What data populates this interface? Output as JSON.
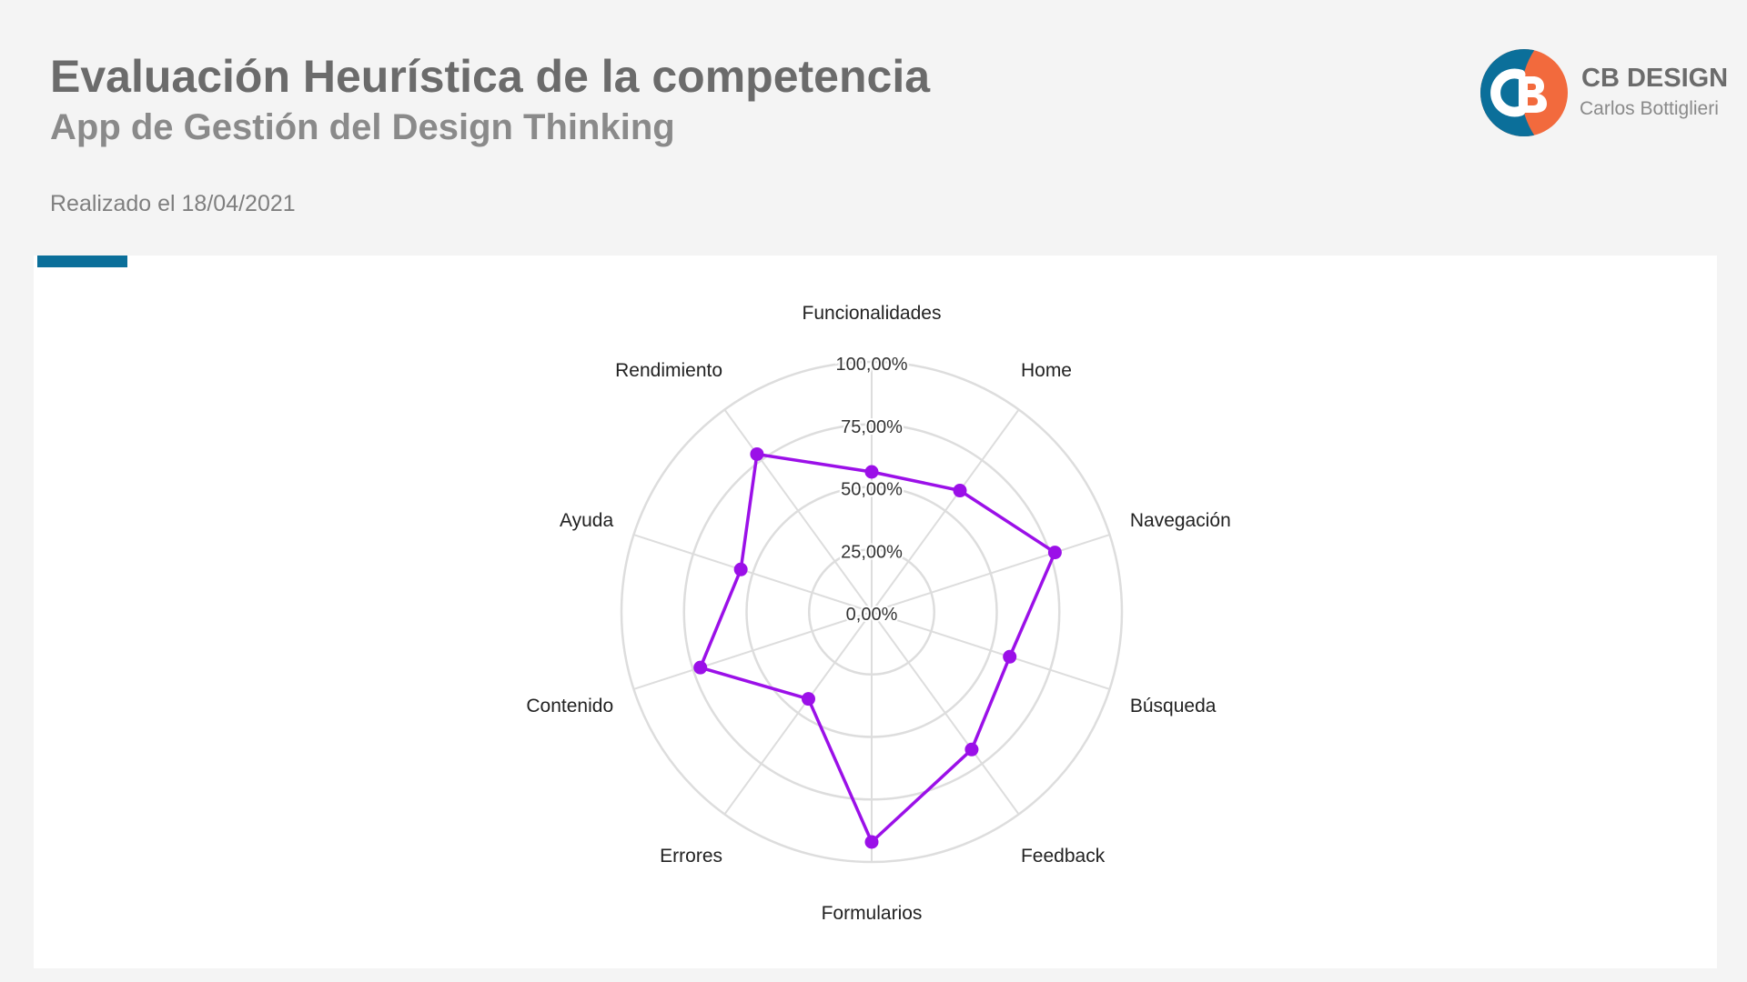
{
  "header": {
    "title": "Evaluación Heurística de la competencia",
    "subtitle": "App de Gestión del Design Thinking",
    "date": "Realizado el 18/04/2021"
  },
  "brand": {
    "name": "CB DESIGN",
    "author": "Carlos Bottiglieri",
    "logo_icon": "cb-logo-icon",
    "colors": {
      "blue": "#0b6f9a",
      "orange": "#f26a3d"
    }
  },
  "colors": {
    "accent": "#0b6f9a",
    "series": "#9b10e8",
    "grid": "#dddddd"
  },
  "chart_data": {
    "type": "radar",
    "categories": [
      "Funcionalidades",
      "Home",
      "Navegación",
      "Búsqueda",
      "Feedback",
      "Formularios",
      "Errores",
      "Contenido",
      "Ayuda",
      "Rendimiento"
    ],
    "series": [
      {
        "values": [
          0.56,
          0.6,
          0.77,
          0.58,
          0.68,
          0.92,
          0.43,
          0.72,
          0.55,
          0.78
        ]
      }
    ],
    "ticks": [
      "0,00%",
      "25,00%",
      "50,00%",
      "75,00%",
      "100,00%"
    ],
    "range": [
      0,
      1
    ],
    "grid": true,
    "legend": "none"
  }
}
